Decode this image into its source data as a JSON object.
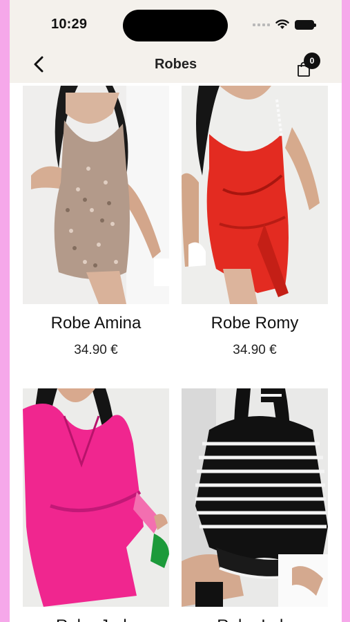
{
  "status_bar": {
    "time": "10:29"
  },
  "header": {
    "title": "Robes",
    "cart_count": "0"
  },
  "products": [
    {
      "name": "Robe Amina",
      "price": "34.90 €"
    },
    {
      "name": "Robe Romy",
      "price": "34.90 €"
    },
    {
      "name": "Robe Jade",
      "price": ""
    },
    {
      "name": "Robe Lola",
      "price": ""
    }
  ],
  "colors": {
    "background_frame": "#f6a8ea",
    "header_bg": "#f4f1ec"
  }
}
